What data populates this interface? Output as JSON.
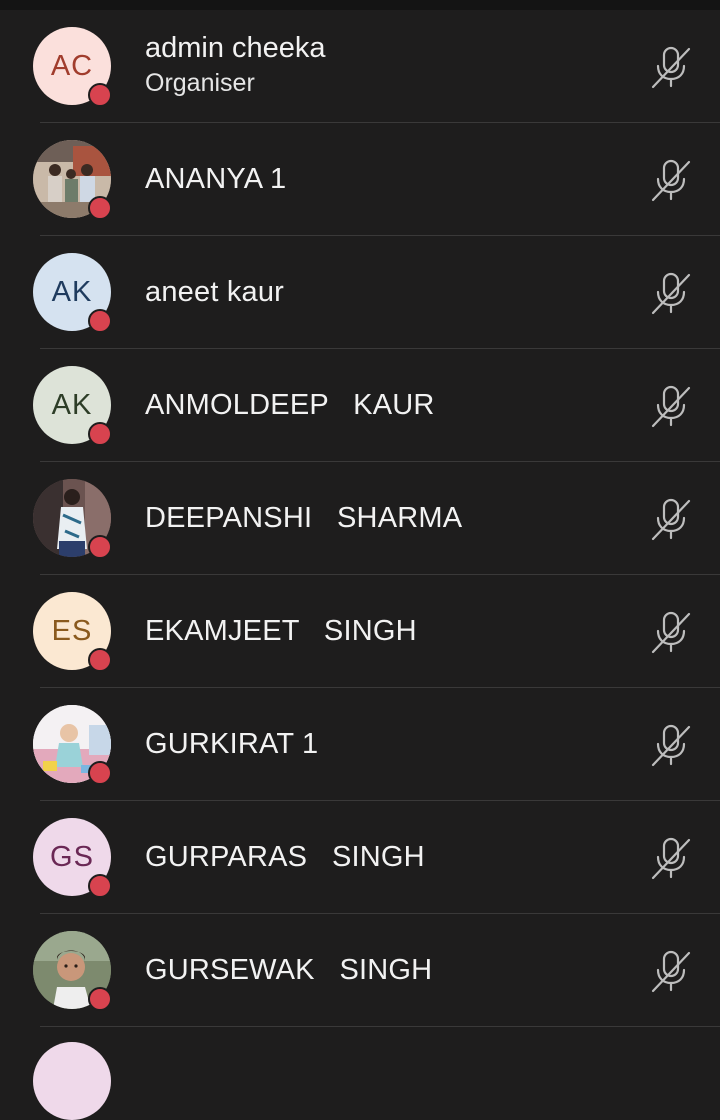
{
  "participants": [
    {
      "name": "admin cheeka",
      "role": "Organiser",
      "initials": "AC",
      "avatar_bg": "#fbe0dc",
      "avatar_fg": "#a13d2d",
      "photo": false
    },
    {
      "name": "ANANYA 1",
      "initials": "",
      "photo": true,
      "photo_scene": "family"
    },
    {
      "name": "aneet kaur",
      "initials": "AK",
      "avatar_bg": "#d5e2f0",
      "avatar_fg": "#1f3b5e",
      "photo": false
    },
    {
      "name": "ANMOLDEEP   KAUR",
      "initials": "AK",
      "avatar_bg": "#dde3d8",
      "avatar_fg": "#2d3d27",
      "photo": false
    },
    {
      "name": "DEEPANSHI   SHARMA",
      "initials": "",
      "photo": true,
      "photo_scene": "girl-standing"
    },
    {
      "name": "EKAMJEET   SINGH",
      "initials": "ES",
      "avatar_bg": "#fbe8d2",
      "avatar_fg": "#8a5a1e",
      "photo": false
    },
    {
      "name": "GURKIRAT 1",
      "initials": "",
      "photo": true,
      "photo_scene": "baby"
    },
    {
      "name": "GURPARAS   SINGH",
      "initials": "GS",
      "avatar_bg": "#efd9ea",
      "avatar_fg": "#6a2855",
      "photo": false
    },
    {
      "name": "GURSEWAK   SINGH",
      "initials": "",
      "photo": true,
      "photo_scene": "child-portrait"
    }
  ],
  "colors": {
    "background": "#1e1d1d",
    "divider": "#3a3939",
    "presence": "#d8434f",
    "mic_icon": "#bdbdbd"
  },
  "icons": {
    "mic_status": "mic-off-icon",
    "presence": "presence-dot-icon"
  }
}
